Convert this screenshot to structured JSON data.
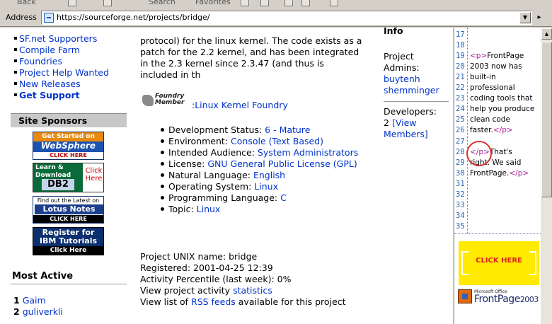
{
  "toolbar": {
    "back_label": "Back",
    "search_label": "Search",
    "favorites_label": "Favorites"
  },
  "address_bar": {
    "label": "Address",
    "url": "https://sourceforge.net/projects/bridge/"
  },
  "left_nav": {
    "items": [
      "SF.net Supporters",
      "Compile Farm",
      "Foundries",
      "Project Help Wanted",
      "New Releases",
      "Get Support"
    ],
    "sponsors_heading": "Site Sponsors",
    "ads": {
      "websphere": {
        "line1": "Get Started on",
        "line2": "WebSphere",
        "cta": "CLICK HERE"
      },
      "db2": {
        "line1": "Learn &",
        "line2": "Download",
        "product": "DB2",
        "cta": "Click Here"
      },
      "lotus": {
        "line1": "Find out the Latest on",
        "line2": "Lotus Notes",
        "cta": "CLICK HERE"
      },
      "ibm": {
        "line1": "Register for",
        "line2": "IBM Tutorials",
        "cta": "Click Here"
      }
    },
    "most_active_heading": "Most Active",
    "most_active": [
      {
        "rank": "1",
        "name": "Gaim"
      },
      {
        "rank": "2",
        "name": "guliverkli"
      }
    ]
  },
  "description": {
    "lines": [
      "protocol) for the linux kernel. The code exists as a",
      "patch for the 2.2 kernel, and has been integrated",
      "in the 2.3 kernel since 2.3.47 (and thus is",
      "included in th"
    ]
  },
  "foundry": {
    "badge_line1": "Foundry",
    "badge_line2": "Member",
    "link": ":Linux Kernel Foundry"
  },
  "trove": [
    {
      "label": "Development Status:",
      "value": "6 - Mature"
    },
    {
      "label": "Environment:",
      "value": "Console (Text Based)"
    },
    {
      "label": "Intended Audience:",
      "value": "System Administrators"
    },
    {
      "label": "License:",
      "value": "GNU General Public License (GPL)"
    },
    {
      "label": "Natural Language:",
      "value": "English"
    },
    {
      "label": "Operating System:",
      "value": "Linux"
    },
    {
      "label": "Programming Language:",
      "value": "C"
    },
    {
      "label": "Topic:",
      "value": "Linux"
    }
  ],
  "project_info": {
    "unix_name": "Project UNIX name: bridge",
    "registered": "Registered: 2001-04-25 12:39",
    "percentile": "Activity Percentile (last week): 0%",
    "activity_prefix": "View project activity",
    "activity_link": "statistics",
    "rss_prefix": "View list of",
    "rss_link": "RSS feeds",
    "rss_suffix": "available for this project"
  },
  "admin_box": {
    "heading": "Info",
    "admins_label1": "Project",
    "admins_label2": "Admins:",
    "admins": [
      "buytenh",
      "shemminger"
    ],
    "developers_label": "Developers:",
    "developers_count": "2",
    "developers_link1": "[View",
    "developers_link2": "Members]"
  },
  "frontpage_ad": {
    "line_numbers": [
      "17",
      "18",
      "19",
      "20",
      "21",
      "22",
      "23",
      "24",
      "25",
      "26",
      "27",
      "28",
      "29",
      "30",
      "31",
      "32",
      "33",
      "34",
      "35"
    ],
    "code": {
      "tag_open": "<p>",
      "tag_close": "</p>",
      "line1": "FrontPage",
      "line2": "2003 now has",
      "line3": "built-in",
      "line4": "professional",
      "line5": "coding tools that",
      "line6": "help you produce",
      "line7": "clean code",
      "line8": "faster.",
      "line9": "That's",
      "line10": "right. We said",
      "line11": "FrontPage."
    },
    "cta": "CLICK HERE",
    "brand_small": "Microsoft Office",
    "brand": "FrontPage",
    "year": "2003"
  }
}
